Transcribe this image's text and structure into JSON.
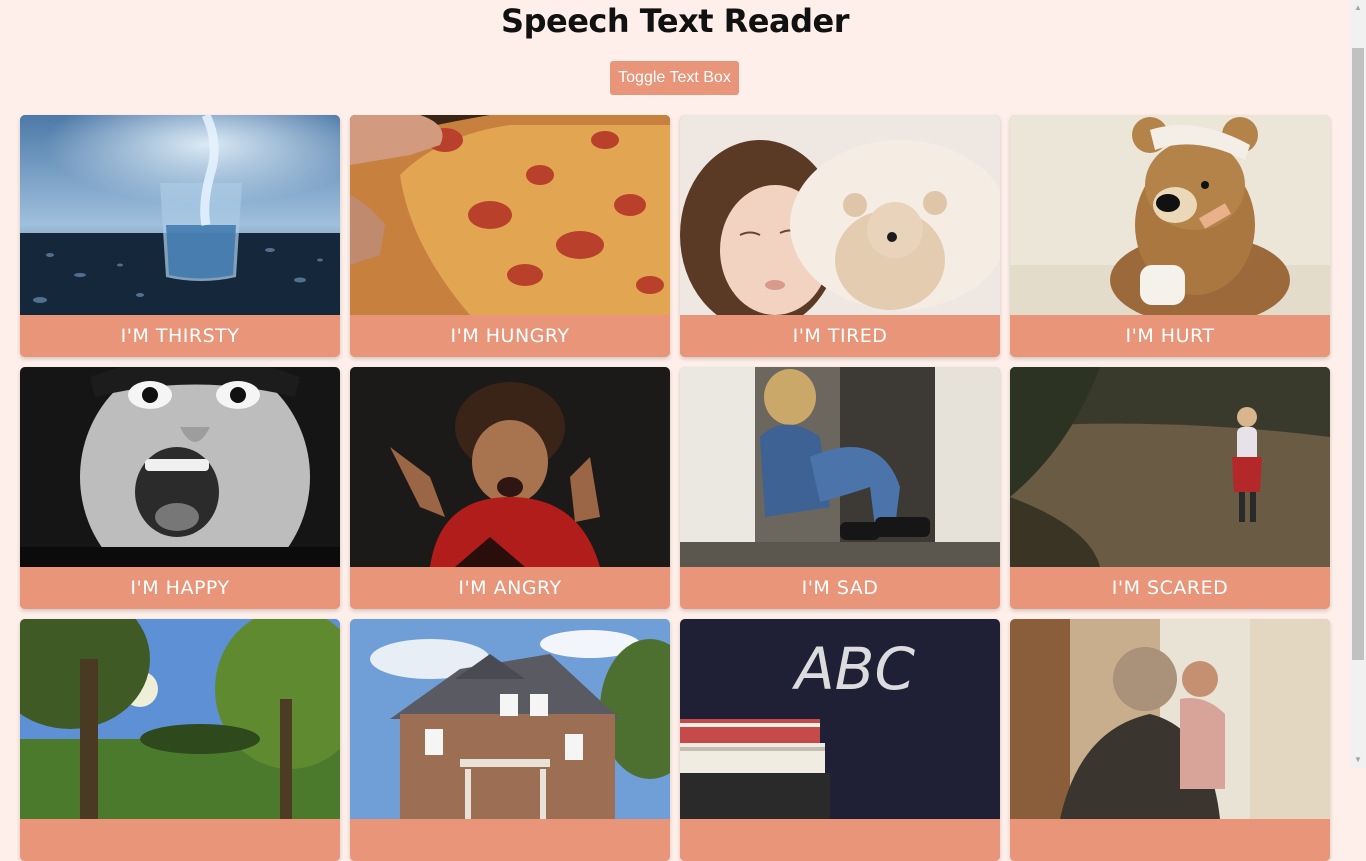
{
  "page": {
    "title": "Speech Text Reader",
    "toggle_label": "Toggle Text Box"
  },
  "cards": [
    {
      "label": "I'M THIRSTY",
      "image": "glass-of-water"
    },
    {
      "label": "I'M HUNGRY",
      "image": "pizza-slice"
    },
    {
      "label": "I'M TIRED",
      "image": "sleeping-child"
    },
    {
      "label": "I'M HURT",
      "image": "bandaged-teddy-bear"
    },
    {
      "label": "I'M HAPPY",
      "image": "excited-boy"
    },
    {
      "label": "I'M ANGRY",
      "image": "angry-boy"
    },
    {
      "label": "I'M SAD",
      "image": "sad-child-in-doorway"
    },
    {
      "label": "I'M SCARED",
      "image": "scared-girl-in-field"
    },
    {
      "label": "",
      "image": "park-with-trees"
    },
    {
      "label": "",
      "image": "house"
    },
    {
      "label": "",
      "image": "abc-chalkboard"
    },
    {
      "label": "",
      "image": "grandmother-and-child"
    }
  ],
  "colors": {
    "background": "#ffefea",
    "accent": "#e8957a",
    "label_text": "#ffffff"
  }
}
